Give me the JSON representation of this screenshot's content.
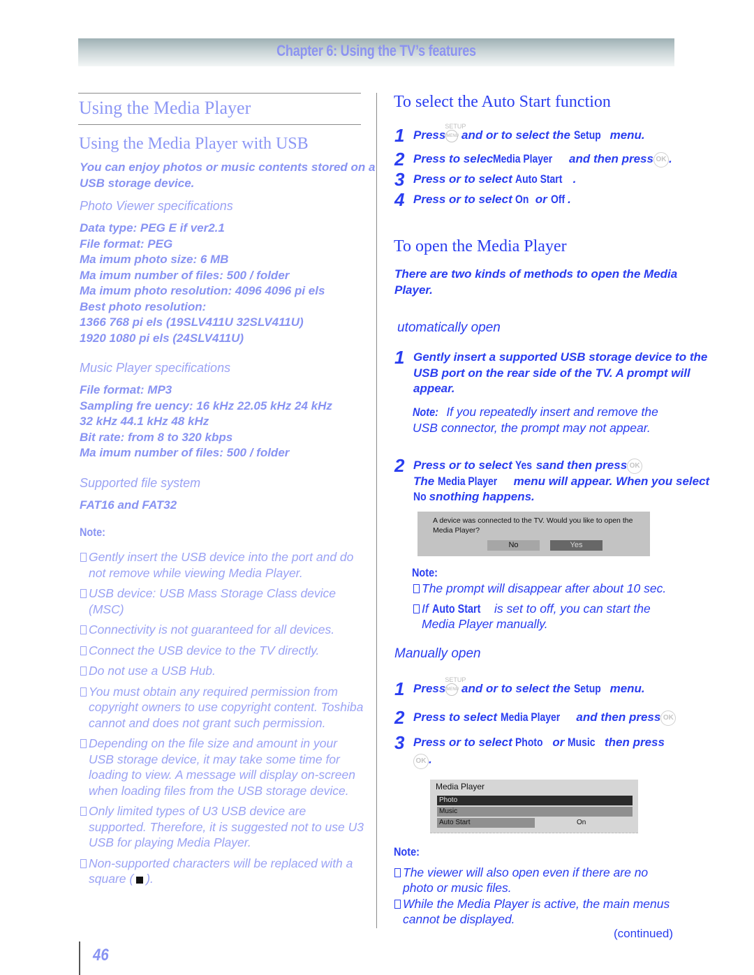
{
  "header": {
    "chapter_title": "Chapter 6: Using the TV’s features"
  },
  "left": {
    "title": "Using the Media Player",
    "subtitle": "Using the Media Player with USB",
    "intro_line1": "You can enjoy photos or music contents stored on a",
    "intro_line2": "USB storage device.",
    "photo_heading": "Photo Viewer specifications",
    "photo_specs": [
      "Data type:  PEG E if ver2.1",
      "File format:  PEG",
      "Ma imum photo size: 6 MB",
      "Ma imum number of files: 500 / folder",
      "Ma imum photo resolution: 4096   4096 pi els",
      "Best photo resolution:",
      "1366   768 pi els (19SLV411U  32SLV411U)",
      "1920   1080 pi els (24SLV411U)"
    ],
    "music_heading": "Music Player specifications",
    "music_specs": [
      "File format: MP3",
      "Sampling fre uency: 16 kHz  22.05 kHz  24 kHz",
      "32 kHz  44.1 kHz  48 kHz",
      "Bit rate: from 8 to 320 kbps",
      "Ma imum number of files: 500 / folder"
    ],
    "fs_heading": "Supported file system",
    "fs_value": "FAT16 and FAT32",
    "note_label": "Note:",
    "notes": [
      "Gently insert the USB device into the port and do not remove while viewing Media Player.",
      "USB device: USB Mass Storage Class device (MSC)",
      "Connectivity is not guaranteed for all devices.",
      "Connect the USB device to the TV directly.",
      "Do not use a USB Hub.",
      "You must obtain any required permission from copyright owners to use copyright content. Toshiba cannot and does not grant such permission.",
      "Depending on the file size and amount in your USB storage device, it may take some time for loading to view. A message will display on-screen when loading files from the USB storage device.",
      "Only limited types of U3 USB device are supported. Therefore, it is suggested not to use U3 USB for playing Media Player."
    ],
    "last_note_pre": "Non-supported characters will be replaced with a square (",
    "last_note_post": ")."
  },
  "right": {
    "autostart_title": "To select the Auto Start function",
    "autostart_steps": [
      {
        "num": "1",
        "a": "Press",
        "b": " and   or   to select the ",
        "em": "Setup",
        "c": " menu."
      },
      {
        "num": "2",
        "a": "Press   to selec",
        "em": "Media Player",
        "c": "  and then press"
      },
      {
        "num": "3",
        "a": "Press   or   to select ",
        "em": "Auto Start",
        "c": "."
      },
      {
        "num": "4",
        "a": "Press   or   to select ",
        "em": "On",
        "mid": " or ",
        "em2": "Off",
        "c": "."
      }
    ],
    "open_title": "To open the Media Player",
    "open_intro": "There are two kinds of methods to open the Media Player.",
    "auto_heading": "utomatically open",
    "auto_step1_num": "1",
    "auto_step1": "Gently insert a supported USB storage device to the USB port on the rear side of the TV. A prompt will appear.",
    "auto_note_label": "Note:",
    "auto_note_text": " If you repeatedly insert and remove the USB connector, the prompt may not appear.",
    "auto_step2_num": "2",
    "auto_step2_a": "Press   or   to select ",
    "auto_step2_yes": "Yes",
    "auto_step2_b": "sand then press",
    "auto_step2_c": "The ",
    "auto_step2_mp": "Media Player",
    "auto_step2_d": " menu will appear. When you select ",
    "auto_step2_no": "No",
    "auto_step2_e": "snothing happens.",
    "prompt": {
      "message": "A device was connected to the TV. Would you like to open the Media Player?",
      "no_label": "No",
      "yes_label": "Yes"
    },
    "note2_label": "Note:",
    "note2_items": [
      {
        "pre": "The prompt will disappear after about 10 sec."
      },
      {
        "pre": "If ",
        "em": "Auto Start",
        "post": "  is set to off, you can start the Media Player manually."
      }
    ],
    "manual_heading": "Manually open",
    "manual_steps": [
      {
        "num": "1",
        "a": "Press",
        "b": " and   or   to select the ",
        "em": "Setup",
        "c": " menu."
      },
      {
        "num": "2",
        "a": "Press   to select ",
        "em": "Media Player",
        "c": "  and then press"
      },
      {
        "num": "3",
        "a": "Press   or   to select ",
        "em": "Photo",
        "mid": " or ",
        "em2": "Music",
        "c": " then press"
      }
    ],
    "media_player_menu": {
      "title": "Media Player",
      "items": [
        "Photo",
        "Music",
        "Auto Start"
      ],
      "auto_start_value": "On",
      "selected": "Photo"
    },
    "note3_label": "Note:",
    "note3_items": [
      "The viewer will also open even if there are no photo or music files.",
      "While the Media Player is active, the main menus cannot be displayed."
    ],
    "continued": "(continued)"
  },
  "icons": {
    "setup_label": "SETUP",
    "menu_label": "MENU",
    "ok_label": "OK"
  },
  "page_number": "46"
}
